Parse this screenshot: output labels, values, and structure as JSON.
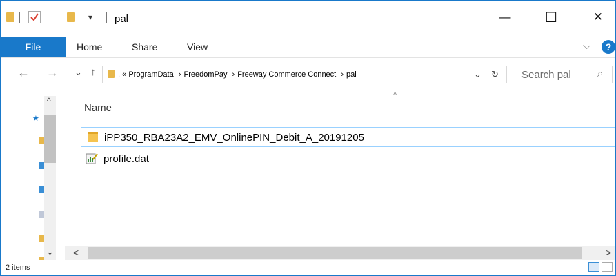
{
  "window": {
    "title": "pal",
    "minimize_glyph": "—",
    "maximize_glyph": "☐",
    "close_glyph": "✕"
  },
  "quick_access": {
    "dropdown_glyph": "▾"
  },
  "ribbon": {
    "file_label": "File",
    "tabs": [
      "Home",
      "Share",
      "View"
    ],
    "expand_glyph": "⌵",
    "help_glyph": "?"
  },
  "address": {
    "overflow_glyph": "« ",
    "breadcrumbs": [
      "ProgramData",
      "FreedomPay",
      "Freeway Commerce Connect",
      "pal"
    ],
    "separator": "›",
    "back_glyph": "←",
    "forward_glyph": "→",
    "recent_glyph": "⌄",
    "up_glyph": "↑",
    "dropdown_glyph": "⌄",
    "refresh_glyph": "↻"
  },
  "search": {
    "placeholder": "Search pal",
    "icon_glyph": "⌕"
  },
  "list": {
    "column_name": "Name",
    "sort_glyph": "^",
    "items": [
      {
        "name": "iPP350_RBA23A2_EMV_OnlinePIN_Debit_A_20191205",
        "type": "folder"
      },
      {
        "name": "profile.dat",
        "type": "dat-file"
      }
    ]
  },
  "scroll": {
    "left_glyph": "<",
    "right_glyph": ">",
    "up_glyph": "^",
    "down_glyph": "⌄"
  },
  "status": {
    "item_count": "2 items"
  },
  "colors": {
    "accent": "#1979ca",
    "folder": "#f5c451",
    "selection_border": "#99d1ff"
  }
}
